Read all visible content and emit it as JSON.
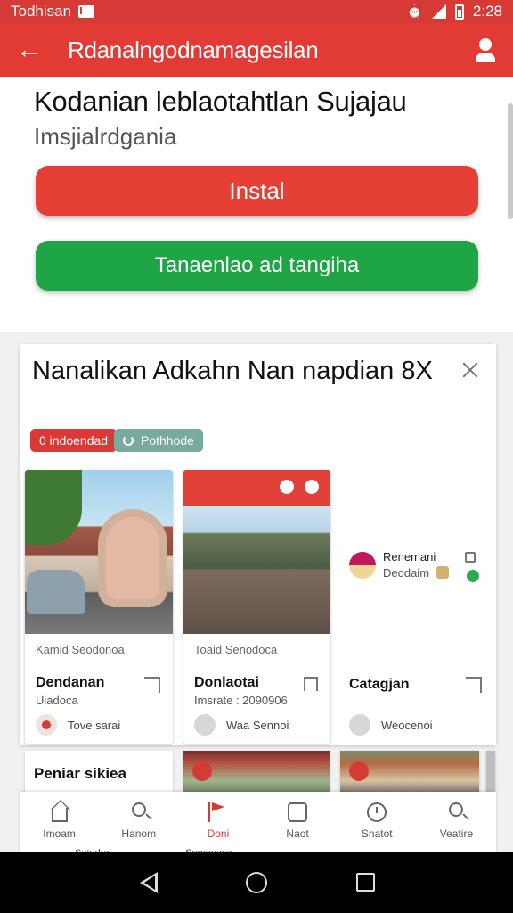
{
  "status_bar": {
    "carrier": "Todhisan",
    "time": "2:28"
  },
  "app_bar": {
    "title": "Rdanalngodnamagesilan"
  },
  "header": {
    "title": "Kodanian leblaotahtlan Sujajau",
    "subtitle": "Imsjialrdgania",
    "install_label": "Instal",
    "secondary_label": "Tanaenlao ad tangiha"
  },
  "promo": {
    "title": "Nanalikan Adkahn Nan napdian 8X",
    "chip_red": "0 indoendad",
    "chip_teal": "Pothhode",
    "tiles": [
      {
        "caption": "Kamid Seodonoa",
        "name": "Dendanan",
        "meta": "Uiadoca",
        "author": "Tove sarai"
      },
      {
        "caption": "Toaid Senodoca",
        "name": "Donlaotai",
        "meta": "Imsrate : 2090906",
        "author": "Waa Sennoi"
      },
      {
        "brand_title": "Renemani",
        "brand_sub": "Deodaim",
        "name": "Catagjan",
        "author": "Weocenoi"
      }
    ],
    "row2_title": "Peniar sikiea"
  },
  "bottom_nav": [
    {
      "label": "Imoam",
      "icon": "home-icon"
    },
    {
      "label": "Hanom",
      "icon": "search-icon"
    },
    {
      "label": "Doni",
      "icon": "flag-icon"
    },
    {
      "label": "Naot",
      "icon": "grid-icon"
    },
    {
      "label": "Snatot",
      "icon": "clock-icon"
    },
    {
      "label": "Veatire",
      "icon": "search-icon"
    }
  ],
  "peek_labels": {
    "left": "Satodrai",
    "center": "Semanasa"
  },
  "colors": {
    "primary_red": "#e23b35",
    "install_red": "#e53f36",
    "green": "#1ea545",
    "teal_chip": "#78aaa0"
  }
}
